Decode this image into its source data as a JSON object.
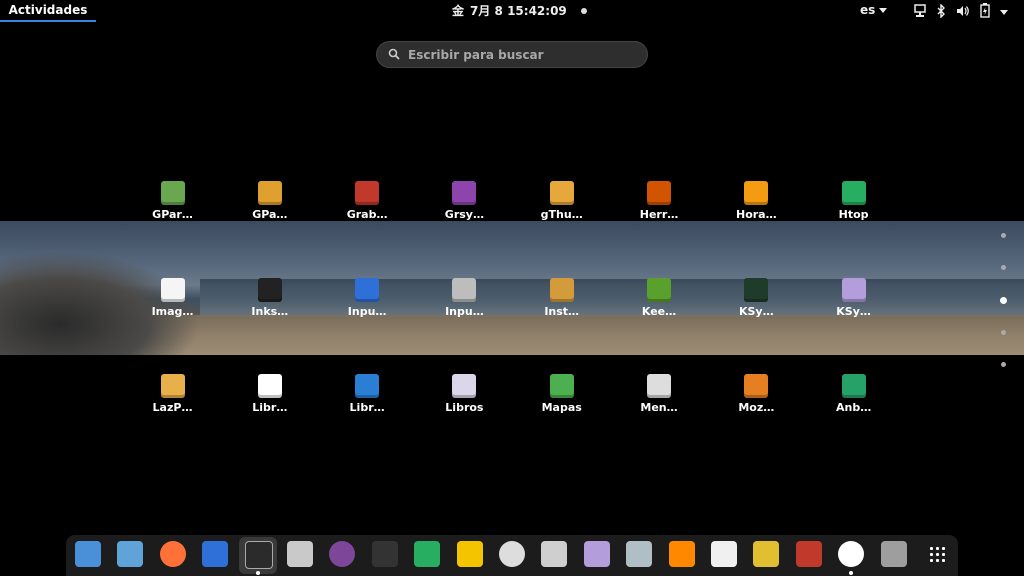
{
  "topbar": {
    "activities": "Actividades",
    "clock": "7月 8  15:42:09",
    "clock_prefix": "金",
    "language": "es",
    "system_icons": [
      "network-icon",
      "bluetooth-icon",
      "volume-icon",
      "battery-icon",
      "power-menu-icon"
    ]
  },
  "search": {
    "placeholder": "Escribir para buscar"
  },
  "apps": [
    {
      "label": "GPar…",
      "icon": "gparted-icon",
      "color": "#6aa84f"
    },
    {
      "label": "GPa…",
      "icon": "gpaste-icon",
      "color": "#e0a030"
    },
    {
      "label": "Grab…",
      "icon": "recorder-icon",
      "color": "#c0392b"
    },
    {
      "label": "Grsy…",
      "icon": "grsync-icon",
      "color": "#8e44ad"
    },
    {
      "label": "gThu…",
      "icon": "gthumb-icon",
      "color": "#e6a83b"
    },
    {
      "label": "Herr…",
      "icon": "tools-icon",
      "color": "#d35400"
    },
    {
      "label": "Hora…",
      "icon": "clock-app-icon",
      "color": "#f39c12"
    },
    {
      "label": "Htop",
      "icon": "htop-icon",
      "color": "#27ae60"
    },
    {
      "label": "Imag…",
      "icon": "image-viewer-icon",
      "color": "#f5f5f5"
    },
    {
      "label": "Inks…",
      "icon": "inkscape-icon",
      "color": "#222222"
    },
    {
      "label": "Inpu…",
      "icon": "input-remapper-icon",
      "color": "#2f6fd8"
    },
    {
      "label": "Inpu…",
      "icon": "keyboard-icon",
      "color": "#bdbdbd"
    },
    {
      "label": "Inst…",
      "icon": "installer-icon",
      "color": "#d39b3a"
    },
    {
      "label": "Kee…",
      "icon": "keepassxc-icon",
      "color": "#5aa02c"
    },
    {
      "label": "KSy…",
      "icon": "ksysguard-icon",
      "color": "#1f3b2a"
    },
    {
      "label": "KSy…",
      "icon": "ksystemlog-icon",
      "color": "#b39ddb"
    },
    {
      "label": "LazP…",
      "icon": "lazpaint-icon",
      "color": "#e8b04a"
    },
    {
      "label": "Libr…",
      "icon": "libreoffice-icon",
      "color": "#ffffff"
    },
    {
      "label": "Libr…",
      "icon": "writer-icon",
      "color": "#2a7fd4"
    },
    {
      "label": "Libros",
      "icon": "books-icon",
      "color": "#dcd6ea"
    },
    {
      "label": "Mapas",
      "icon": "maps-icon",
      "color": "#4caf50"
    },
    {
      "label": "Men…",
      "icon": "menu-editor-icon",
      "color": "#dddddd"
    },
    {
      "label": "Moz…",
      "icon": "mozc-icon",
      "color": "#e67e22"
    },
    {
      "label": "Anb…",
      "icon": "android-icon",
      "color": "#26a269"
    }
  ],
  "pages": {
    "count": 5,
    "current": 3
  },
  "dock": [
    {
      "name": "software-store-icon",
      "color": "#4a90d9",
      "running": false
    },
    {
      "name": "screenshot-app-icon",
      "color": "#5fa3d9",
      "running": false
    },
    {
      "name": "firefox-icon",
      "color": "#ff7139",
      "running": false
    },
    {
      "name": "thunderbird-icon",
      "color": "#2f6fd8",
      "running": false
    },
    {
      "name": "terminal-icon",
      "color": "#2b2b2b",
      "running": true
    },
    {
      "name": "image-viewer-icon",
      "color": "#c9c9c9",
      "running": false
    },
    {
      "name": "tor-browser-icon",
      "color": "#7d4698",
      "running": false
    },
    {
      "name": "system-monitor-icon",
      "color": "#333333",
      "running": false
    },
    {
      "name": "htop-icon",
      "color": "#27ae60",
      "running": false
    },
    {
      "name": "text-editor-icon",
      "color": "#f5c400",
      "running": false
    },
    {
      "name": "settings-gear-icon",
      "color": "#dddddd",
      "running": false
    },
    {
      "name": "file-cabinet-icon",
      "color": "#cfcfcf",
      "running": false
    },
    {
      "name": "ksystemlog-icon",
      "color": "#b39ddb",
      "running": false
    },
    {
      "name": "stamp-tool-icon",
      "color": "#b0bec5",
      "running": false
    },
    {
      "name": "vlc-icon",
      "color": "#ff8800",
      "running": false
    },
    {
      "name": "toggle-app-icon",
      "color": "#f0f0f0",
      "running": false
    },
    {
      "name": "cleaner-icon",
      "color": "#e0c030",
      "running": false
    },
    {
      "name": "package-manager-icon",
      "color": "#c0392b",
      "running": false
    },
    {
      "name": "circle-app-icon",
      "color": "#ffffff",
      "running": true
    },
    {
      "name": "trash-icon",
      "color": "#9e9e9e",
      "running": false
    }
  ]
}
